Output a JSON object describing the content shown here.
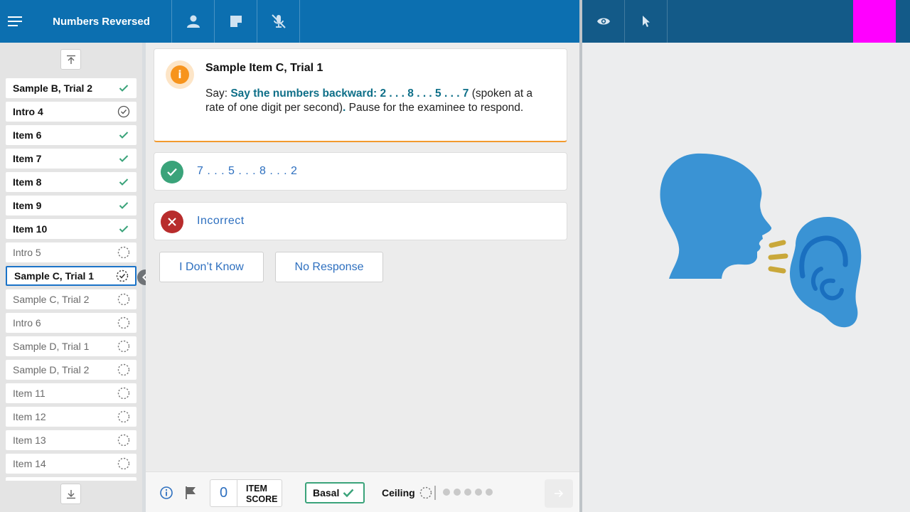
{
  "header": {
    "title": "Numbers Reversed"
  },
  "sidebar": {
    "items": [
      {
        "label": "Sample B, Trial 2",
        "state": "done"
      },
      {
        "label": "Intro 4",
        "state": "done-intro"
      },
      {
        "label": "Item 6",
        "state": "done"
      },
      {
        "label": "Item 7",
        "state": "done"
      },
      {
        "label": "Item 8",
        "state": "done"
      },
      {
        "label": "Item 9",
        "state": "done"
      },
      {
        "label": "Item 10",
        "state": "done"
      },
      {
        "label": "Intro 5",
        "state": "pending"
      },
      {
        "label": "Sample C, Trial 1",
        "state": "active"
      },
      {
        "label": "Sample C, Trial 2",
        "state": "pending"
      },
      {
        "label": "Intro 6",
        "state": "pending"
      },
      {
        "label": "Sample D, Trial 1",
        "state": "pending"
      },
      {
        "label": "Sample D, Trial 2",
        "state": "pending"
      },
      {
        "label": "Item 11",
        "state": "pending"
      },
      {
        "label": "Item 12",
        "state": "pending"
      },
      {
        "label": "Item 13",
        "state": "pending"
      },
      {
        "label": "Item 14",
        "state": "pending"
      }
    ]
  },
  "info_card": {
    "title": "Sample Item C, Trial 1",
    "say_prefix": "Say: ",
    "say_strong": "Say the numbers backward: 2 . . . 8 . . . 5 . . . 7",
    "say_rest": " (spoken at a rate of one digit per second)",
    "say_period": ".",
    "say_end": " Pause for the examinee to respond."
  },
  "responses": {
    "correct_text": "7 . . . 5 . . . 8 . . . 2",
    "incorrect_text": "Incorrect"
  },
  "buttons": {
    "dont_know": "I Don’t Know",
    "no_response": "No Response"
  },
  "bottom": {
    "item_score": "0",
    "item_score_label_1": "ITEM",
    "item_score_label_2": "SCORE",
    "basal_label": "Basal",
    "ceiling_label": "Ceiling",
    "ceiling_dots": 5
  },
  "colors": {
    "header_blue": "#0c6fb0",
    "header_dark": "#135a88",
    "accent_orange": "#f7941d",
    "correct_green": "#3aa37a",
    "incorrect_red": "#b82c2c",
    "say_teal": "#0e6f88",
    "illustration_blue": "#3a93d4"
  }
}
